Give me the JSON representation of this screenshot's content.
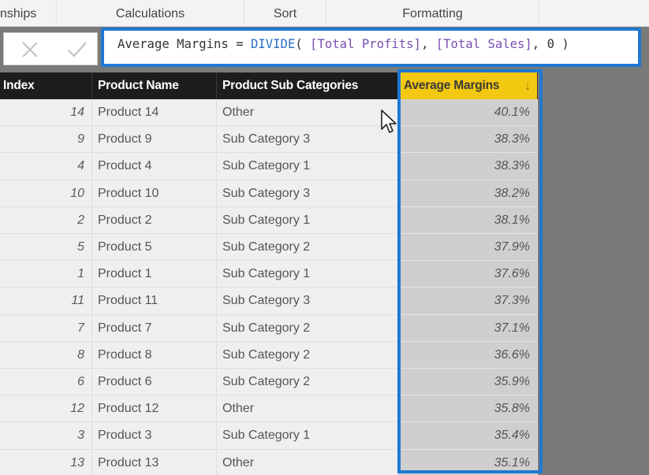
{
  "ribbon": {
    "groups": [
      "nships",
      "Calculations",
      "Sort",
      "Formatting",
      ""
    ]
  },
  "formula_bar": {
    "cancel_icon": "close-icon",
    "commit_icon": "check-icon",
    "formula_parts": {
      "measure_name": "Average Margins = ",
      "function": "DIVIDE",
      "open": "( ",
      "arg1": "[Total Profits]",
      "sep1": ", ",
      "arg2": "[Total Sales]",
      "rest": ", 0 )"
    },
    "formula_text": "Average Margins = DIVIDE( [Total Profits], [Total Sales], 0 )"
  },
  "table": {
    "columns": [
      "Index",
      "Product Name",
      "Product Sub Categories",
      "Average Margins"
    ],
    "sort_icon": "sort-descending-icon",
    "highlight_color": "#f2c811",
    "selection_color": "#1f78d1",
    "rows": [
      {
        "index": "14",
        "name": "Product 14",
        "sub": "Other",
        "avg": "40.1%"
      },
      {
        "index": "9",
        "name": "Product 9",
        "sub": "Sub Category 3",
        "avg": "38.3%"
      },
      {
        "index": "4",
        "name": "Product 4",
        "sub": "Sub Category 1",
        "avg": "38.3%"
      },
      {
        "index": "10",
        "name": "Product 10",
        "sub": "Sub Category 3",
        "avg": "38.2%"
      },
      {
        "index": "2",
        "name": "Product 2",
        "sub": "Sub Category 1",
        "avg": "38.1%"
      },
      {
        "index": "5",
        "name": "Product 5",
        "sub": "Sub Category 2",
        "avg": "37.9%"
      },
      {
        "index": "1",
        "name": "Product 1",
        "sub": "Sub Category 1",
        "avg": "37.6%"
      },
      {
        "index": "11",
        "name": "Product 11",
        "sub": "Sub Category 3",
        "avg": "37.3%"
      },
      {
        "index": "7",
        "name": "Product 7",
        "sub": "Sub Category 2",
        "avg": "37.1%"
      },
      {
        "index": "8",
        "name": "Product 8",
        "sub": "Sub Category 2",
        "avg": "36.6%"
      },
      {
        "index": "6",
        "name": "Product 6",
        "sub": "Sub Category 2",
        "avg": "35.9%"
      },
      {
        "index": "12",
        "name": "Product 12",
        "sub": "Other",
        "avg": "35.8%"
      },
      {
        "index": "3",
        "name": "Product 3",
        "sub": "Sub Category 1",
        "avg": "35.4%"
      },
      {
        "index": "13",
        "name": "Product 13",
        "sub": "Other",
        "avg": "35.1%"
      }
    ]
  }
}
